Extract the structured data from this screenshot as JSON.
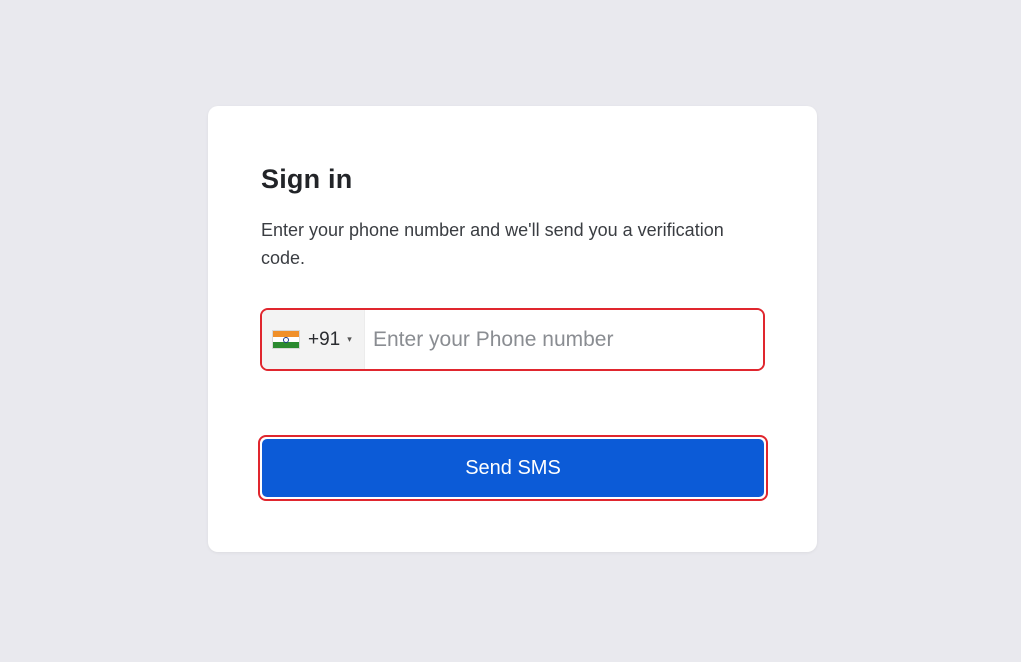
{
  "signin": {
    "title": "Sign in",
    "subtitle": "Enter your phone number and we'll send you a verification code."
  },
  "phone": {
    "country_flag": "india-flag-icon",
    "dial_code": "+91",
    "caret": "▾",
    "placeholder": "Enter your Phone number",
    "value": ""
  },
  "actions": {
    "send_label": "Send SMS"
  },
  "colors": {
    "background": "#e9e9ee",
    "card": "#ffffff",
    "primary": "#0c5bd7",
    "highlight_border": "#e0262e"
  }
}
